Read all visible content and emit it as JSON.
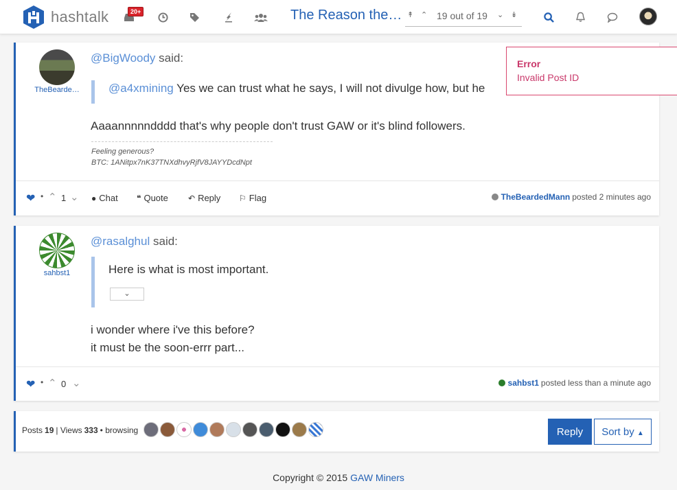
{
  "header": {
    "brand": "hashtalk",
    "notif_badge": "20+",
    "topic_title": "The Reason the…",
    "pager_text": "19 out of 19"
  },
  "posts": [
    {
      "username": "TheBearde…",
      "mention": "@BigWoody",
      "said": "said:",
      "quote_mention": "@a4xmining",
      "quote_text": "Yes we can trust what he says, I will not divulge how, but he",
      "body": "Aaaannnnndddd that's why people don't trust GAW or it's blind followers.",
      "sig_line1": "Feeling generous?",
      "sig_line2": "BTC: 1ANitpx7nK37TNXdhvyRjfV8JAYYDcdNpt",
      "upvotes": "1",
      "chat": "Chat",
      "quote": "Quote",
      "reply": "Reply",
      "flag": "Flag",
      "poster": "TheBeardedMann",
      "posted_text": "posted 2 minutes ago",
      "status_color": "#888888"
    },
    {
      "username": "sahbst1",
      "mention": "@rasalghul",
      "said": "said:",
      "quote_text": "Here is what is most important.",
      "body_line1": "i wonder where i've this before?",
      "body_line2": "it must be the soon-errr part...",
      "upvotes": "0",
      "poster": "sahbst1",
      "posted_text": "posted less than a minute ago",
      "status_color": "#2b7d2b"
    }
  ],
  "bottom": {
    "posts_label": "Posts",
    "posts_count": "19",
    "views_label": "| Views",
    "views_count": "333",
    "browsing_label": "• browsing",
    "reply_button": "Reply",
    "sort_button": "Sort by"
  },
  "copyright": {
    "text": "Copyright © 2015",
    "brand": "GAW Miners"
  },
  "toast": {
    "title": "Error",
    "message": "Invalid Post ID"
  },
  "colors": {
    "accent": "#2461b4",
    "error": "#c9386a"
  }
}
